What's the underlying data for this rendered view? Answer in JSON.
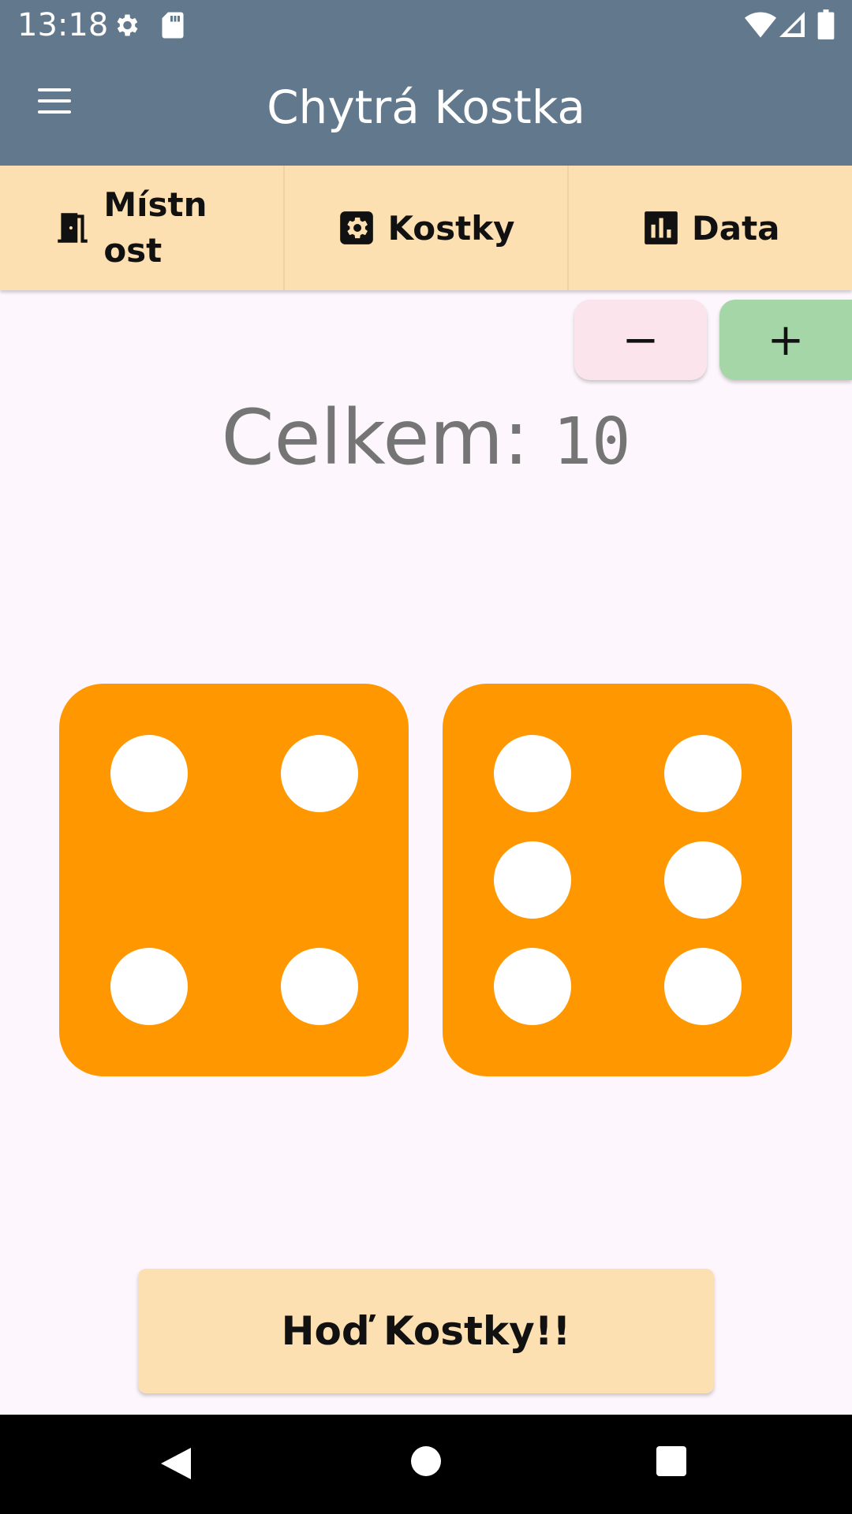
{
  "status_bar": {
    "time": "13:18",
    "icons": [
      "settings-icon",
      "sd-card-icon",
      "wifi-icon",
      "signal-icon",
      "battery-icon"
    ]
  },
  "app_bar": {
    "menu_icon": "hamburger-menu-icon",
    "title": "Chytrá Kostka"
  },
  "tabs": [
    {
      "label": "Místnost",
      "icon": "door-icon"
    },
    {
      "label": "Kostky",
      "icon": "gear-icon"
    },
    {
      "label": "Data",
      "icon": "bar-chart-icon"
    }
  ],
  "stepper": {
    "minus_label": "−",
    "plus_label": "+"
  },
  "total": {
    "label": "Celkem:",
    "value": "10"
  },
  "dice": [
    {
      "value": 4
    },
    {
      "value": 6
    }
  ],
  "roll_button": {
    "label": "Hoď Kostky!!"
  },
  "colors": {
    "app_bar": "#62788c",
    "tab_bar": "#fde0b1",
    "die": "#ff9800",
    "pip": "#ffffff",
    "minus_button": "#fbe4ec",
    "plus_button": "#a5d6a7",
    "background": "#fdf6fc"
  },
  "nav_bar": {
    "icons": [
      "back-icon",
      "home-icon",
      "recents-icon"
    ]
  }
}
